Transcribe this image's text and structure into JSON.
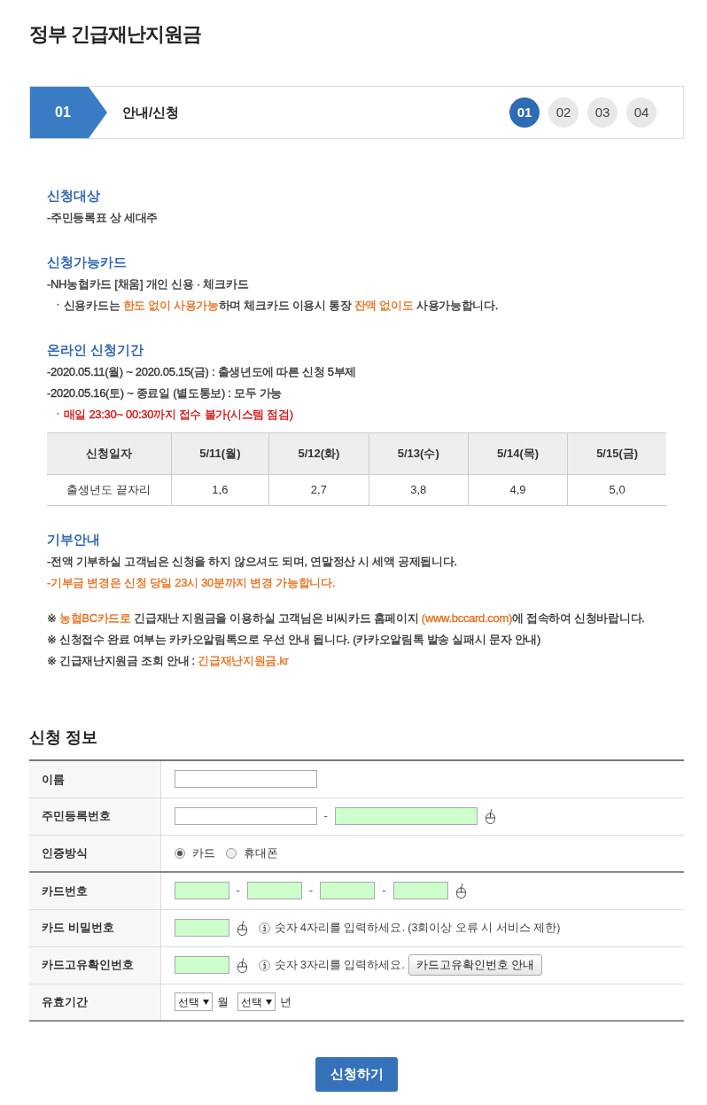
{
  "page": {
    "title": "정부 긴급재난지원금"
  },
  "stepper": {
    "current": {
      "number": "01",
      "label": "안내/신청"
    },
    "steps": [
      {
        "label": "01",
        "selected": true
      },
      {
        "label": "02",
        "selected": false
      },
      {
        "label": "03",
        "selected": false
      },
      {
        "label": "04",
        "selected": false
      }
    ]
  },
  "sections": [
    {
      "heading": "신청대상",
      "lines": [
        {
          "kind": "dash",
          "parts": [
            {
              "text": "-주민등록표 상 세대주",
              "color": "#333333"
            }
          ]
        }
      ]
    },
    {
      "heading": "신청가능카드",
      "lines": [
        {
          "kind": "dash",
          "parts": [
            {
              "text": "-NH농협카드 [채움] 개인 신용 · 체크카드",
              "color": "#333333"
            }
          ]
        },
        {
          "kind": "dot",
          "parts": [
            {
              "text": "ㆍ신용카드는 ",
              "color": "#333333"
            },
            {
              "text": "한도 없이 사용가능",
              "color": "#e8701e"
            },
            {
              "text": "하며 체크카드 이용시 통장 ",
              "color": "#333333"
            },
            {
              "text": "잔액 없이도",
              "color": "#e8701e"
            },
            {
              "text": " 사용가능합니다.",
              "color": "#333333"
            }
          ]
        }
      ]
    },
    {
      "heading": "온라인 신청기간",
      "lines": [
        {
          "kind": "dash",
          "parts": [
            {
              "text": "-2020.05.11(월) ~ 2020.05.15(금) : 출생년도에 따른 신청 5부제",
              "color": "#333333"
            }
          ]
        },
        {
          "kind": "dash",
          "parts": [
            {
              "text": "-2020.05.16(토) ~ 종료일 (별도통보) : 모두 가능",
              "color": "#333333"
            }
          ]
        },
        {
          "kind": "dot",
          "parts": [
            {
              "text": "ㆍ매일 23:30~ 00:30까지 접수 불가(시스템 점검)",
              "color": "#d40f0f"
            }
          ]
        }
      ],
      "table": {
        "columns": [
          "신청일자",
          "5/11(월)",
          "5/12(화)",
          "5/13(수)",
          "5/14(목)",
          "5/15(금)"
        ],
        "rows": [
          [
            "출생년도 끝자리",
            "1,6",
            "2,7",
            "3,8",
            "4,9",
            "5,0"
          ]
        ]
      }
    },
    {
      "heading": "기부안내",
      "lines": [
        {
          "kind": "dash",
          "parts": [
            {
              "text": "-전액 기부하실 고객님은 신청을 하지 않으셔도 되며, 연말정산 시 세액 공제됩니다.",
              "color": "#333333"
            }
          ]
        },
        {
          "kind": "dash",
          "parts": [
            {
              "text": "-기부금 변경은 신청 당일 23시 30분까지 변경 가능합니다.",
              "color": "#e8701e"
            }
          ]
        }
      ]
    }
  ],
  "notes": [
    {
      "parts": [
        {
          "text": "※ ",
          "color": "#333333"
        },
        {
          "text": "농협BC카드로",
          "color": "#e8701e"
        },
        {
          "text": " 긴급재난 지원금을 이용하실 고객님은 비씨카드 홈페이지 ",
          "color": "#333333"
        },
        {
          "text": "(www.bccard.com)",
          "color": "#e8701e"
        },
        {
          "text": "에 접속하여 신청바랍니다.",
          "color": "#333333"
        }
      ]
    },
    {
      "parts": [
        {
          "text": "※ 신청접수 완료 여부는 카카오알림톡으로 우선 안내 됩니다. (카카오알림톡 발송 실패시 문자 안내)",
          "color": "#333333"
        }
      ]
    },
    {
      "parts": [
        {
          "text": "※ 긴급재난지원금 조회 안내 : ",
          "color": "#333333"
        },
        {
          "text": "긴급재난지원금.kr",
          "color": "#e8701e"
        }
      ]
    }
  ],
  "form": {
    "title": "신청 정보",
    "groups": [
      {
        "rows": [
          {
            "label": "이름",
            "kind": "fields",
            "fields": [
              {
                "secure": false
              }
            ]
          },
          {
            "label": "주민등록번호",
            "kind": "fields",
            "keypad": true,
            "fields": [
              {
                "secure": false
              },
              {
                "prefix": "-",
                "secure": true
              }
            ]
          },
          {
            "label": "인증방식",
            "kind": "radio",
            "options": [
              {
                "label": "카드",
                "selected": true
              },
              {
                "label": "휴대폰",
                "selected": false
              }
            ]
          }
        ]
      },
      {
        "rows": [
          {
            "label": "카드번호",
            "kind": "fields",
            "keypad": true,
            "fields": [
              {
                "secure": true
              },
              {
                "prefix": "-",
                "secure": true
              },
              {
                "prefix": "-",
                "secure": true
              },
              {
                "prefix": "-",
                "secure": true
              }
            ]
          },
          {
            "label": "카드 비밀번호",
            "kind": "fields",
            "keypad": true,
            "fields": [
              {
                "secure": true
              }
            ],
            "hint": "숫자 4자리를 입력하세요. (3회이상 오류 시 서비스 제한)"
          },
          {
            "label": "카드고유확인번호",
            "kind": "fields",
            "keypad": true,
            "fields": [
              {
                "secure": true
              }
            ],
            "hint": "숫자 3자리를 입력하세요.",
            "button": "카드고유확인번호 안내"
          },
          {
            "label": "유효기간",
            "kind": "select",
            "selects": [
              {
                "value": "선택",
                "unit": "월"
              },
              {
                "value": "선택",
                "unit": "년"
              }
            ]
          }
        ]
      }
    ]
  },
  "submit": "신청하기"
}
